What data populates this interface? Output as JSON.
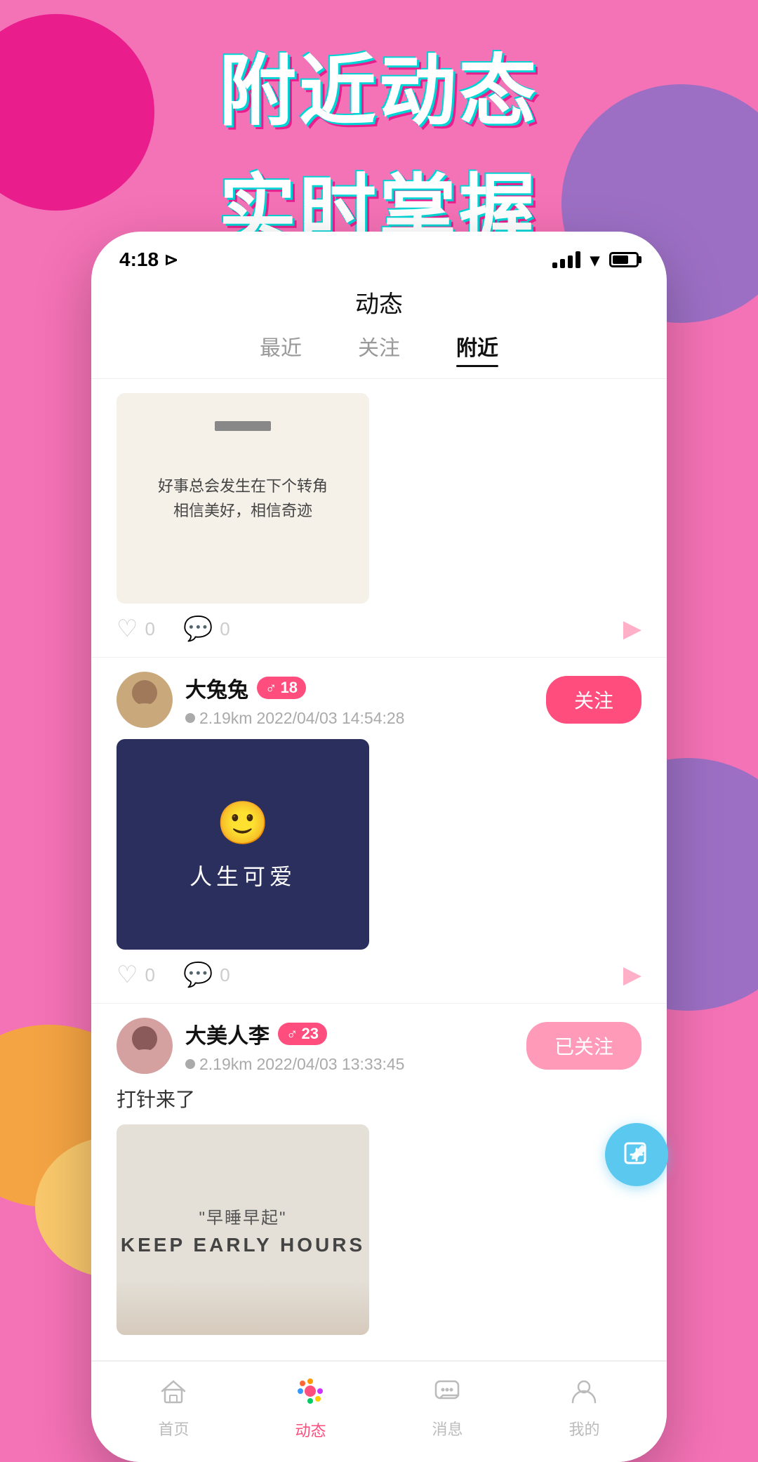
{
  "background": {
    "color": "#f472b6"
  },
  "hero": {
    "line1": "附近动态",
    "line2": "实时掌握"
  },
  "phone": {
    "statusBar": {
      "time": "4:18",
      "locationIcon": "⊳"
    },
    "navTitle": "动态",
    "tabs": [
      {
        "label": "最近",
        "active": false
      },
      {
        "label": "关注",
        "active": false
      },
      {
        "label": "附近",
        "active": true
      }
    ],
    "posts": [
      {
        "id": "post-1",
        "hasHeader": false,
        "imageType": "handwriting",
        "imageText": "好事总会发生在下个转角，相信美好，相信奇迹",
        "likes": "0",
        "comments": "0"
      },
      {
        "id": "post-2",
        "hasHeader": true,
        "username": "大兔兔",
        "gender": "♂",
        "age": "18",
        "distance": "2.19km",
        "date": "2022/04/03 14:54:28",
        "followed": false,
        "followLabel": "关注",
        "imageType": "smiley",
        "imageText": "人生可爱",
        "likes": "0",
        "comments": "0"
      },
      {
        "id": "post-3",
        "hasHeader": true,
        "username": "大美人李",
        "gender": "♂",
        "age": "23",
        "distance": "2.19km",
        "date": "2022/04/03 13:33:45",
        "followed": true,
        "followLabel": "已关注",
        "postText": "打针来了",
        "imageType": "keep",
        "imageText": "\"早睡早起\"\nKEEP EARLY HOURS",
        "likes": "0",
        "comments": "0"
      }
    ],
    "bottomNav": [
      {
        "label": "首页",
        "icon": "🏠",
        "active": false
      },
      {
        "label": "动态",
        "icon": "🌸",
        "active": true
      },
      {
        "label": "消息",
        "icon": "💬",
        "active": false
      },
      {
        "label": "我的",
        "icon": "👤",
        "active": false
      }
    ],
    "composeIcon": "✏"
  }
}
